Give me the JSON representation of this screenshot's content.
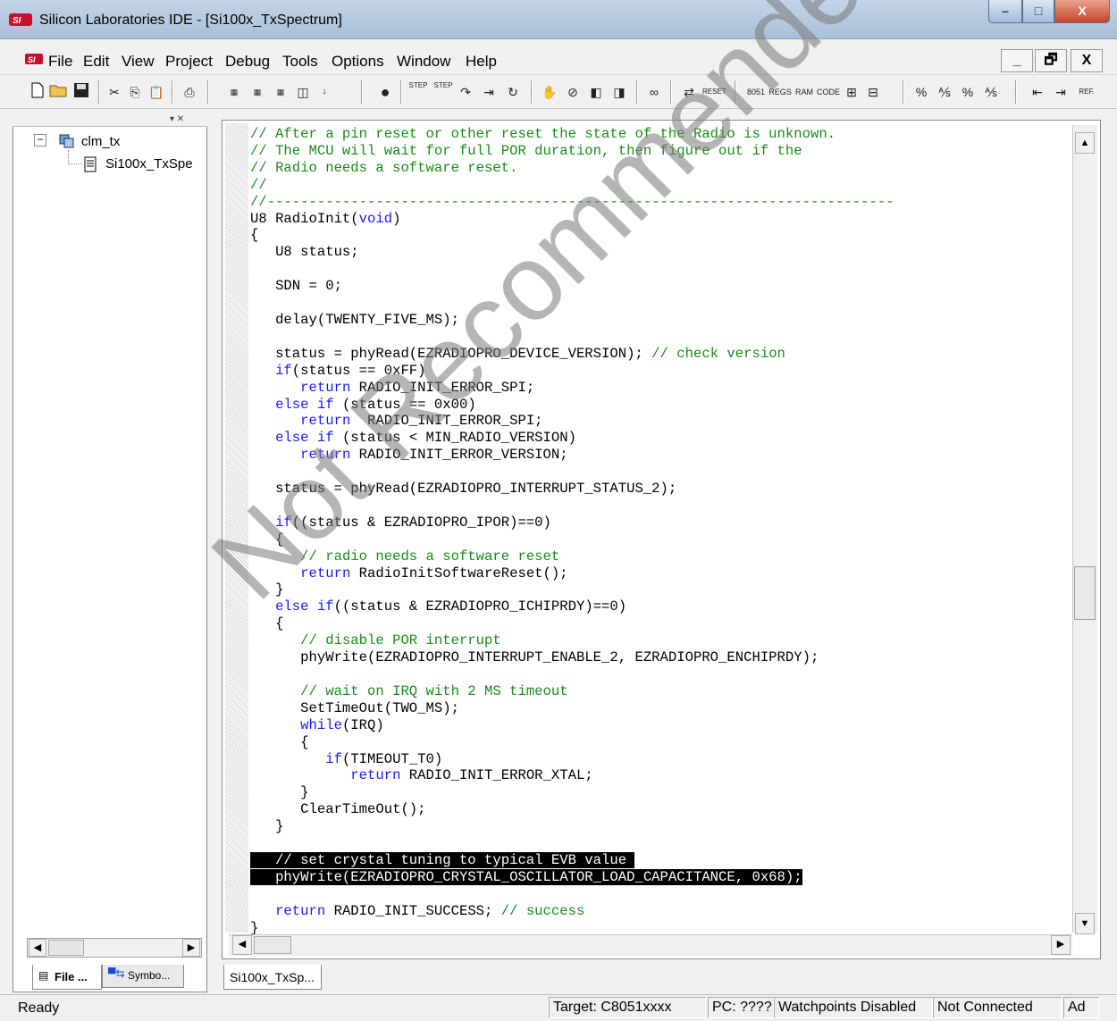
{
  "window": {
    "title": "Silicon Laboratories IDE - [Si100x_TxSpectrum]",
    "controls": {
      "minimize": "–",
      "maximize": "□",
      "close": "X"
    }
  },
  "menubar": {
    "items": [
      "File",
      "Edit",
      "View",
      "Project",
      "Debug",
      "Tools",
      "Options",
      "Window",
      "Help"
    ],
    "mdi_controls": {
      "minimize": "_",
      "restore": "🗗",
      "close": "X"
    }
  },
  "toolbar": {
    "groups": [
      [
        "new-file-icon",
        "open-folder-icon",
        "save-icon",
        "cut-icon",
        "copy-icon",
        "paste-icon",
        "print-icon"
      ],
      [
        "build-icon",
        "build-all-icon",
        "download-icon",
        "stop-build-icon",
        "breakpoint-icon"
      ],
      [
        "step-icon",
        "step-over-icon",
        "step-out-icon",
        "run-to-cursor-icon",
        "go-icon",
        "halt-icon",
        "reset-icon"
      ],
      [
        "8051-icon",
        "regs-icon",
        "ram-icon",
        "code-icon"
      ]
    ],
    "labels": {
      "step1": "STEP",
      "step2": "STEP",
      "reset": "RESET",
      "r8051": "8051",
      "regs": "REGS",
      "ram": "RAM",
      "code": "CODE",
      "ref": "REF."
    }
  },
  "project_tree": {
    "root": "clm_tx",
    "child": "Si100x_TxSpe"
  },
  "left_tabs": {
    "file": "File ...",
    "symbols": "Symbo..."
  },
  "editor": {
    "document_tab": "Si100x_TxSp...",
    "code": [
      [
        {
          "t": "// After a pin reset or other reset the state of the Radio is unknown.",
          "c": "cm"
        }
      ],
      [
        {
          "t": "// The MCU will wait for full POR duration, then figure out if the",
          "c": "cm"
        }
      ],
      [
        {
          "t": "// Radio needs a software reset.",
          "c": "cm"
        }
      ],
      [
        {
          "t": "//",
          "c": "cm"
        }
      ],
      [
        {
          "t": "//---------------------------------------------------------------------------",
          "c": "cm"
        }
      ],
      [
        {
          "t": "U8 RadioInit("
        },
        {
          "t": "void",
          "c": "kw"
        },
        {
          "t": ")"
        }
      ],
      [
        {
          "t": "{"
        }
      ],
      [
        {
          "t": "   U8 status;"
        }
      ],
      [
        {
          "t": ""
        }
      ],
      [
        {
          "t": "   SDN = 0;"
        }
      ],
      [
        {
          "t": ""
        }
      ],
      [
        {
          "t": "   delay(TWENTY_FIVE_MS);"
        }
      ],
      [
        {
          "t": ""
        }
      ],
      [
        {
          "t": "   status = phyRead(EZRADIOPRO_DEVICE_VERSION); "
        },
        {
          "t": "// check version",
          "c": "cm"
        }
      ],
      [
        {
          "t": "   "
        },
        {
          "t": "if",
          "c": "kw"
        },
        {
          "t": "(status == 0xFF)"
        }
      ],
      [
        {
          "t": "      "
        },
        {
          "t": "return",
          "c": "kw"
        },
        {
          "t": " RADIO_INIT_ERROR_SPI;"
        }
      ],
      [
        {
          "t": "   "
        },
        {
          "t": "else if",
          "c": "kw"
        },
        {
          "t": " (status == 0x00)"
        }
      ],
      [
        {
          "t": "      "
        },
        {
          "t": "return",
          "c": "kw"
        },
        {
          "t": "  RADIO_INIT_ERROR_SPI;"
        }
      ],
      [
        {
          "t": "   "
        },
        {
          "t": "else if",
          "c": "kw"
        },
        {
          "t": " (status < MIN_RADIO_VERSION)"
        }
      ],
      [
        {
          "t": "      "
        },
        {
          "t": "return",
          "c": "kw"
        },
        {
          "t": " RADIO_INIT_ERROR_VERSION;"
        }
      ],
      [
        {
          "t": ""
        }
      ],
      [
        {
          "t": "   status = phyRead(EZRADIOPRO_INTERRUPT_STATUS_2);"
        }
      ],
      [
        {
          "t": ""
        }
      ],
      [
        {
          "t": "   "
        },
        {
          "t": "if",
          "c": "kw"
        },
        {
          "t": "((status & EZRADIOPRO_IPOR)==0)"
        }
      ],
      [
        {
          "t": "   {"
        }
      ],
      [
        {
          "t": "      "
        },
        {
          "t": "// radio needs a software reset",
          "c": "cm"
        }
      ],
      [
        {
          "t": "      "
        },
        {
          "t": "return",
          "c": "kw"
        },
        {
          "t": " RadioInitSoftwareReset();"
        }
      ],
      [
        {
          "t": "   }"
        }
      ],
      [
        {
          "t": "   "
        },
        {
          "t": "else if",
          "c": "kw"
        },
        {
          "t": "((status & EZRADIOPRO_ICHIPRDY)==0)"
        }
      ],
      [
        {
          "t": "   {"
        }
      ],
      [
        {
          "t": "      "
        },
        {
          "t": "// disable POR interrupt",
          "c": "cm"
        }
      ],
      [
        {
          "t": "      phyWrite(EZRADIOPRO_INTERRUPT_ENABLE_2, EZRADIOPRO_ENCHIPRDY);"
        }
      ],
      [
        {
          "t": ""
        }
      ],
      [
        {
          "t": "      "
        },
        {
          "t": "// wait on IRQ with 2 MS timeout",
          "c": "cm"
        }
      ],
      [
        {
          "t": "      SetTimeOut(TWO_MS);"
        }
      ],
      [
        {
          "t": "      "
        },
        {
          "t": "while",
          "c": "kw"
        },
        {
          "t": "(IRQ)"
        }
      ],
      [
        {
          "t": "      {"
        }
      ],
      [
        {
          "t": "         "
        },
        {
          "t": "if",
          "c": "kw"
        },
        {
          "t": "(TIMEOUT_T0)"
        }
      ],
      [
        {
          "t": "            "
        },
        {
          "t": "return",
          "c": "kw"
        },
        {
          "t": " RADIO_INIT_ERROR_XTAL;"
        }
      ],
      [
        {
          "t": "      }"
        }
      ],
      [
        {
          "t": "      ClearTimeOut();"
        }
      ],
      [
        {
          "t": "   }"
        }
      ],
      [
        {
          "t": ""
        }
      ],
      [
        {
          "t": "   // set crystal tuning to typical EVB value ",
          "c": "hl"
        }
      ],
      [
        {
          "t": "   phyWrite(EZRADIOPRO_CRYSTAL_OSCILLATOR_LOAD_CAPACITANCE, 0x68);",
          "c": "hl"
        }
      ],
      [
        {
          "t": ""
        }
      ],
      [
        {
          "t": "   "
        },
        {
          "t": "return",
          "c": "kw"
        },
        {
          "t": " RADIO_INIT_SUCCESS; "
        },
        {
          "t": "// success",
          "c": "cm"
        }
      ],
      [
        {
          "t": "}"
        }
      ]
    ]
  },
  "statusbar": {
    "ready": "Ready",
    "target": "Target: C8051xxxx",
    "pc": "PC: ????",
    "watchpoints": "Watchpoints Disabled",
    "connection": "Not Connected",
    "mode": "Ad"
  },
  "watermark": "Not Recommended for New Designs",
  "colors": {
    "comment": "#1a8a1a",
    "keyword": "#1a1aff",
    "selection": "#000000"
  }
}
